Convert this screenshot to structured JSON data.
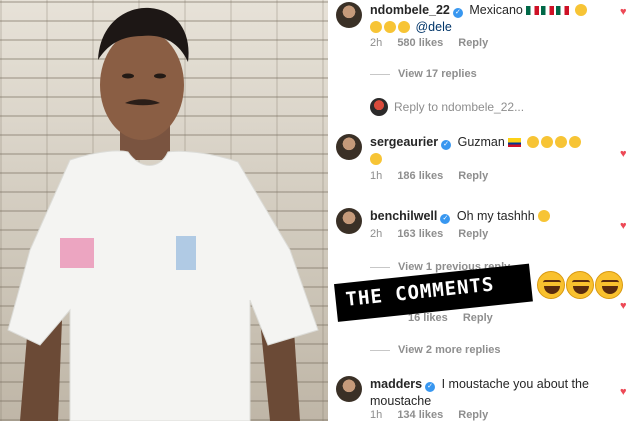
{
  "comments": [
    {
      "username": "ndombele_22",
      "text_prefix": "Mexicano",
      "mention": "@dele",
      "time": "2h",
      "likes": "580 likes",
      "reply": "Reply",
      "view_replies": "View 17 replies",
      "reply_to": "Reply to ndombele_22..."
    },
    {
      "username": "sergeaurier",
      "text_prefix": "Guzman",
      "time": "1h",
      "likes": "186 likes",
      "reply": "Reply"
    },
    {
      "username": "benchilwell",
      "text_prefix": "Oh my tashhh",
      "time": "2h",
      "likes": "163 likes",
      "reply": "Reply",
      "view_replies": "View 1 previous reply"
    },
    {
      "hidden_likes": "16 likes",
      "reply": "Reply",
      "view_replies": "View 2 more replies"
    },
    {
      "username": "madders",
      "text_prefix": "I moustache you about the moustache",
      "time": "1h",
      "likes": "134 likes",
      "reply": "Reply"
    }
  ],
  "banner": {
    "text": "THE COMMENTS"
  },
  "colors": {
    "heart": "#ed4956",
    "verified": "#3897f0",
    "muted": "#8e8e8e"
  },
  "icons": [
    "heart-icon",
    "verified-icon",
    "laughing-emoji-icon",
    "mexico-flag-icon",
    "colombia-flag-icon"
  ]
}
